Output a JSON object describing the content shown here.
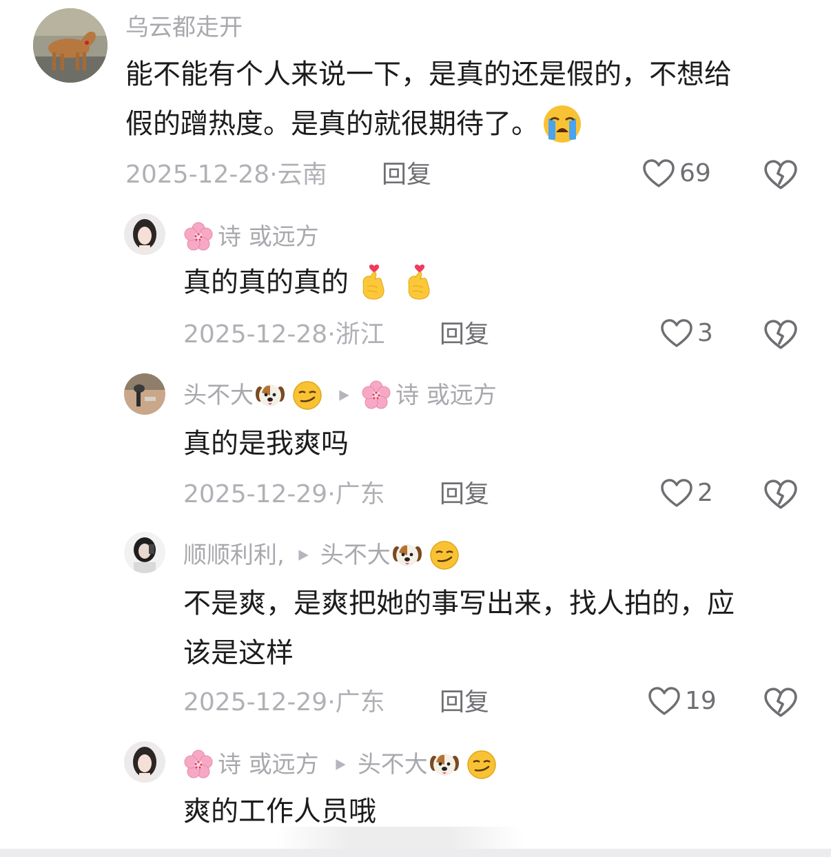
{
  "comments": [
    {
      "username": "乌云都走开",
      "text_lines": [
        "能不能有个人来说一下，是真的还是假的，不想给",
        "假的蹭热度。是真的就很期待了。"
      ],
      "text_emoji": "loudly-crying-face",
      "date": "2025-12-28",
      "region": "云南",
      "reply_label": "回复",
      "likes": "69"
    },
    {
      "username": "诗 或远方",
      "user_emoji": "cherry-blossom",
      "text": "真的真的真的",
      "text_emoji": "finger-heart x2",
      "date": "2025-12-28",
      "region": "浙江",
      "reply_label": "回复",
      "likes": "3"
    },
    {
      "username": "头不大",
      "user_emoji": "dog-face, smirking-face",
      "reply_to": "诗 或远方",
      "reply_to_emoji": "cherry-blossom",
      "text": "真的是我爽吗",
      "date": "2025-12-29",
      "region": "广东",
      "reply_label": "回复",
      "likes": "2"
    },
    {
      "username": "顺顺利利,",
      "reply_to": "头不大",
      "reply_to_emoji": "dog-face, smirking-face",
      "text_lines": [
        "不是爽，是爽把她的事写出来，找人拍的，应",
        "该是这样"
      ],
      "date": "2025-12-29",
      "region": "广东",
      "reply_label": "回复",
      "likes": "19"
    },
    {
      "username": "诗 或远方",
      "user_emoji": "cherry-blossom",
      "reply_to": "头不大",
      "reply_to_emoji": "dog-face, smirking-face",
      "text": "爽的工作人员哦"
    }
  ],
  "colors": {
    "text": "#1c1c1e",
    "muted": "#a8a8ae",
    "action": "#6e6e73",
    "background": "#ffffff"
  }
}
